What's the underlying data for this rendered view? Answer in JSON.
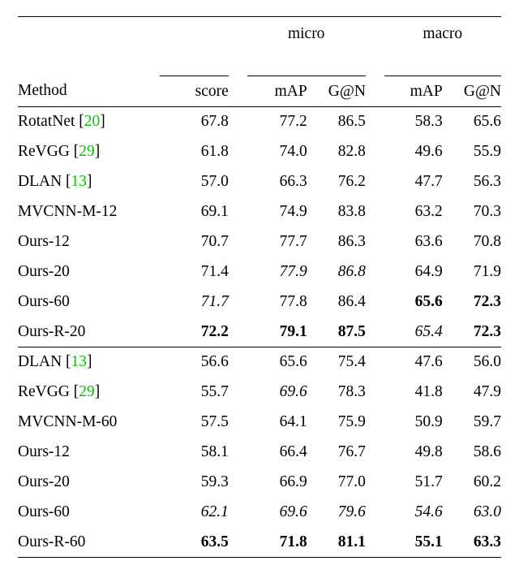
{
  "headers": {
    "method": "Method",
    "score": "score",
    "micro": "micro",
    "macro": "macro",
    "mAP": "mAP",
    "GN": "G@N"
  },
  "rows_a": [
    {
      "method": "RotatNet",
      "cite": "20",
      "score": "67.8",
      "m_map": "77.2",
      "m_gn": "86.5",
      "M_map": "58.3",
      "M_gn": "65.6"
    },
    {
      "method": "ReVGG",
      "cite": "29",
      "score": "61.8",
      "m_map": "74.0",
      "m_gn": "82.8",
      "M_map": "49.6",
      "M_gn": "55.9"
    },
    {
      "method": "DLAN",
      "cite": "13",
      "score": "57.0",
      "m_map": "66.3",
      "m_gn": "76.2",
      "M_map": "47.7",
      "M_gn": "56.3"
    },
    {
      "method": "MVCNN-M-12",
      "score": "69.1",
      "m_map": "74.9",
      "m_gn": "83.8",
      "M_map": "63.2",
      "M_gn": "70.3"
    },
    {
      "method": "Ours-12",
      "score": "70.7",
      "m_map": "77.7",
      "m_gn": "86.3",
      "M_map": "63.6",
      "M_gn": "70.8"
    },
    {
      "method": "Ours-20",
      "score": "71.4",
      "m_map": "77.9",
      "m_gn": "86.8",
      "M_map": "64.9",
      "M_gn": "71.9",
      "ital": [
        "m_map",
        "m_gn"
      ]
    },
    {
      "method": "Ours-60",
      "score": "71.7",
      "m_map": "77.8",
      "m_gn": "86.4",
      "M_map": "65.6",
      "M_gn": "72.3",
      "ital": [
        "score"
      ],
      "bold": [
        "M_map",
        "M_gn"
      ]
    },
    {
      "method": "Ours-R-20",
      "score": "72.2",
      "m_map": "79.1",
      "m_gn": "87.5",
      "M_map": "65.4",
      "M_gn": "72.3",
      "bold": [
        "score",
        "m_map",
        "m_gn",
        "M_gn"
      ],
      "ital": [
        "M_map"
      ]
    }
  ],
  "rows_b": [
    {
      "method": "DLAN",
      "cite": "13",
      "score": "56.6",
      "m_map": "65.6",
      "m_gn": "75.4",
      "M_map": "47.6",
      "M_gn": "56.0"
    },
    {
      "method": "ReVGG",
      "cite": "29",
      "score": "55.7",
      "m_map": "69.6",
      "m_gn": "78.3",
      "M_map": "41.8",
      "M_gn": "47.9",
      "ital": [
        "m_map"
      ]
    },
    {
      "method": "MVCNN-M-60",
      "score": "57.5",
      "m_map": "64.1",
      "m_gn": "75.9",
      "M_map": "50.9",
      "M_gn": "59.7"
    },
    {
      "method": "Ours-12",
      "score": "58.1",
      "m_map": "66.4",
      "m_gn": "76.7",
      "M_map": "49.8",
      "M_gn": "58.6"
    },
    {
      "method": "Ours-20",
      "score": "59.3",
      "m_map": "66.9",
      "m_gn": "77.0",
      "M_map": "51.7",
      "M_gn": "60.2"
    },
    {
      "method": "Ours-60",
      "score": "62.1",
      "m_map": "69.6",
      "m_gn": "79.6",
      "M_map": "54.6",
      "M_gn": "63.0",
      "ital": [
        "score",
        "m_map",
        "m_gn",
        "M_map",
        "M_gn"
      ]
    },
    {
      "method": "Ours-R-60",
      "score": "63.5",
      "m_map": "71.8",
      "m_gn": "81.1",
      "M_map": "55.1",
      "M_gn": "63.3",
      "bold": [
        "score",
        "m_map",
        "m_gn",
        "M_map",
        "M_gn"
      ]
    }
  ],
  "chart_data": {
    "type": "table",
    "title": "",
    "columns": [
      "Method",
      "score",
      "micro mAP",
      "micro G@N",
      "macro mAP",
      "macro G@N"
    ],
    "sections": [
      {
        "rows": [
          [
            "RotatNet [20]",
            67.8,
            77.2,
            86.5,
            58.3,
            65.6
          ],
          [
            "ReVGG [29]",
            61.8,
            74.0,
            82.8,
            49.6,
            55.9
          ],
          [
            "DLAN [13]",
            57.0,
            66.3,
            76.2,
            47.7,
            56.3
          ],
          [
            "MVCNN-M-12",
            69.1,
            74.9,
            83.8,
            63.2,
            70.3
          ],
          [
            "Ours-12",
            70.7,
            77.7,
            86.3,
            63.6,
            70.8
          ],
          [
            "Ours-20",
            71.4,
            77.9,
            86.8,
            64.9,
            71.9
          ],
          [
            "Ours-60",
            71.7,
            77.8,
            86.4,
            65.6,
            72.3
          ],
          [
            "Ours-R-20",
            72.2,
            79.1,
            87.5,
            65.4,
            72.3
          ]
        ]
      },
      {
        "rows": [
          [
            "DLAN [13]",
            56.6,
            65.6,
            75.4,
            47.6,
            56.0
          ],
          [
            "ReVGG [29]",
            55.7,
            69.6,
            78.3,
            41.8,
            47.9
          ],
          [
            "MVCNN-M-60",
            57.5,
            64.1,
            75.9,
            50.9,
            59.7
          ],
          [
            "Ours-12",
            58.1,
            66.4,
            76.7,
            49.8,
            58.6
          ],
          [
            "Ours-20",
            59.3,
            66.9,
            77.0,
            51.7,
            60.2
          ],
          [
            "Ours-60",
            62.1,
            69.6,
            79.6,
            54.6,
            63.0
          ],
          [
            "Ours-R-60",
            63.5,
            71.8,
            81.1,
            55.1,
            63.3
          ]
        ]
      }
    ]
  }
}
